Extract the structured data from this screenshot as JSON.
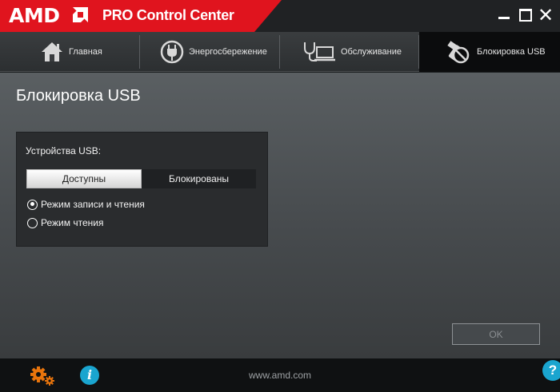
{
  "window": {
    "logo": "AMD",
    "title": "PRO Control Center",
    "close_glyph": "✕"
  },
  "nav": {
    "items": [
      {
        "label": "Главная",
        "icon": "home-icon"
      },
      {
        "label": "Энергосбережение",
        "icon": "power-plug-icon"
      },
      {
        "label": "Обслуживание",
        "icon": "stethoscope-laptop-icon"
      },
      {
        "label": "Блокировка USB",
        "icon": "usb-block-icon",
        "active": true
      }
    ]
  },
  "page": {
    "title": "Блокировка USB",
    "usb_label": "Устройства USB:",
    "toggle": {
      "on": "Доступны",
      "off": "Блокированы",
      "selected": "Доступны"
    },
    "radios": [
      {
        "label": "Режим записи и чтения",
        "checked": true
      },
      {
        "label": "Режим чтения",
        "checked": false
      }
    ],
    "ok": "OK"
  },
  "footer": {
    "url": "www.amd.com",
    "info": "i",
    "help": "?"
  },
  "colors": {
    "brand": "#e0141e",
    "accent": "#1aa5cf",
    "gear": "#e8740c"
  }
}
